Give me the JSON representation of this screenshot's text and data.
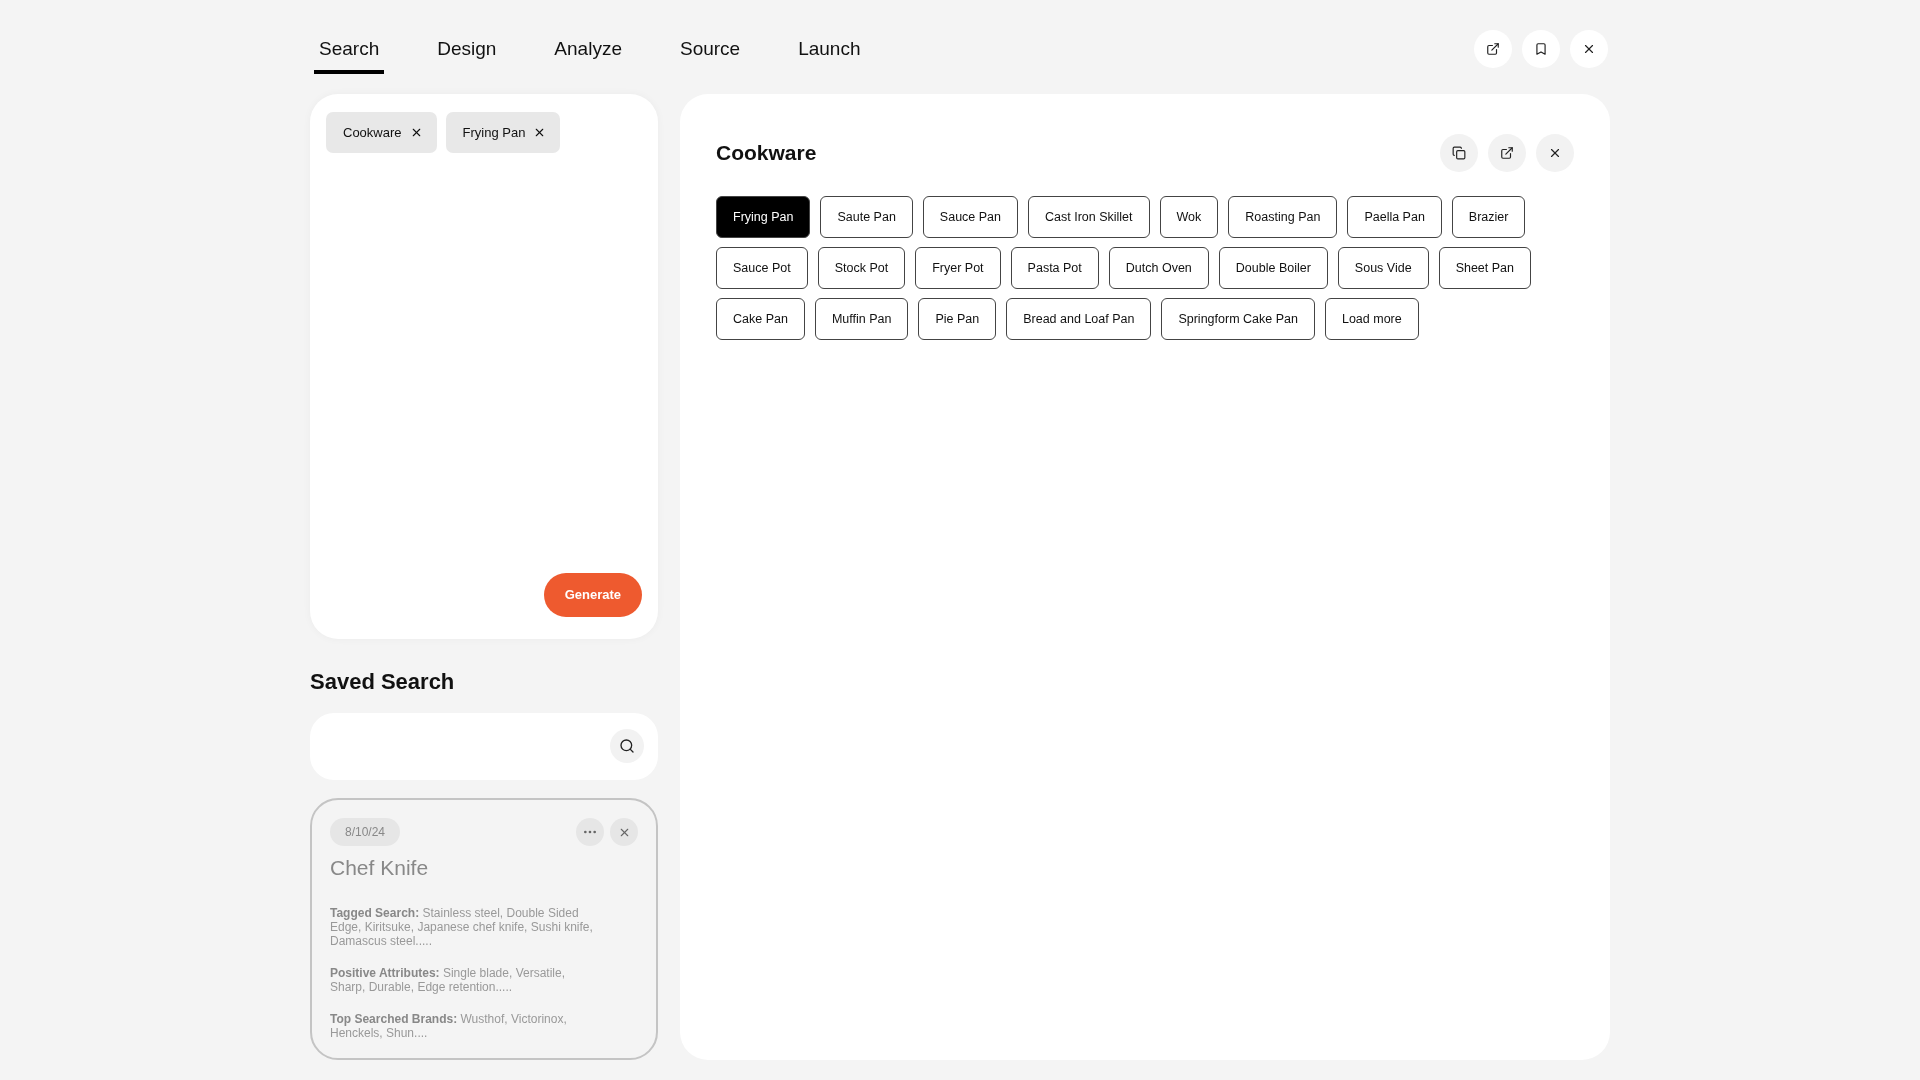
{
  "tabs": [
    {
      "label": "Search",
      "selected": true
    },
    {
      "label": "Design",
      "selected": false
    },
    {
      "label": "Analyze",
      "selected": false
    },
    {
      "label": "Source",
      "selected": false
    },
    {
      "label": "Launch",
      "selected": false
    }
  ],
  "header_actions": [
    {
      "kind": "external"
    },
    {
      "kind": "bookmark"
    },
    {
      "kind": "close"
    }
  ],
  "query": {
    "tags": [
      {
        "label": "Cookware"
      },
      {
        "label": "Frying Pan"
      }
    ],
    "generate_button": "Generate"
  },
  "saved_search": {
    "title": "Saved Search",
    "cards": [
      {
        "date": "8/10/24",
        "title": "Chef Knife",
        "details": [
          "**Tagged Search:** Stainless steel, Double Sided Edge, Kiritsuke, Japanese chef knife, Sushi knife, Damascus steel.....",
          "**Positive Attributes:** Single blade, Versatile, Sharp, Durable, Edge retention.....",
          "**Top Searched Brands:** Wusthof, Victorinox, Henckels, Shun...."
        ]
      }
    ]
  },
  "category": {
    "title": "Cookware",
    "actions": [
      {
        "kind": "copy"
      },
      {
        "kind": "external"
      },
      {
        "kind": "close"
      }
    ],
    "option_rows": [
      [
        {
          "label": "Frying Pan",
          "selected": true
        },
        {
          "label": "Saute Pan",
          "selected": false
        },
        {
          "label": "Sauce Pan",
          "selected": false
        },
        {
          "label": "Cast Iron Skillet",
          "selected": false
        },
        {
          "label": "Wok",
          "selected": false
        },
        {
          "label": "Roasting Pan",
          "selected": false
        },
        {
          "label": "Paella Pan",
          "selected": false
        },
        {
          "label": "Brazier",
          "selected": false
        }
      ],
      [
        {
          "label": "Sauce Pot",
          "selected": false
        },
        {
          "label": "Stock Pot",
          "selected": false
        },
        {
          "label": "Fryer Pot",
          "selected": false
        },
        {
          "label": "Pasta Pot",
          "selected": false
        },
        {
          "label": "Dutch Oven",
          "selected": false
        },
        {
          "label": "Double Boiler",
          "selected": false
        },
        {
          "label": "Sous Vide",
          "selected": false
        },
        {
          "label": "Sheet Pan",
          "selected": false
        }
      ],
      [
        {
          "label": "Cake Pan",
          "selected": false
        },
        {
          "label": "Muffin Pan",
          "selected": false
        },
        {
          "label": "Pie Pan",
          "selected": false
        },
        {
          "label": "Bread and Loaf Pan",
          "selected": false
        },
        {
          "label": "Springform Cake Pan",
          "selected": false
        },
        {
          "label": "Load more",
          "selected": false
        }
      ]
    ]
  }
}
